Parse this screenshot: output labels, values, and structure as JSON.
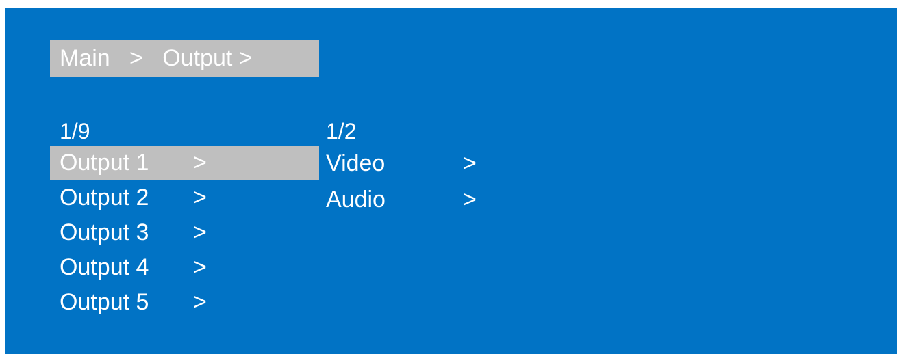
{
  "breadcrumb": {
    "items": [
      "Main",
      "Output"
    ],
    "separator": ">"
  },
  "left_menu": {
    "page_indicator": "1/9",
    "items": [
      {
        "label": "Output 1",
        "arrow": ">",
        "selected": true
      },
      {
        "label": "Output 2",
        "arrow": ">",
        "selected": false
      },
      {
        "label": "Output 3",
        "arrow": ">",
        "selected": false
      },
      {
        "label": "Output 4",
        "arrow": ">",
        "selected": false
      },
      {
        "label": "Output 5",
        "arrow": ">",
        "selected": false
      }
    ]
  },
  "right_menu": {
    "page_indicator": "1/2",
    "items": [
      {
        "label": "Video",
        "arrow": ">"
      },
      {
        "label": "Audio",
        "arrow": ">"
      }
    ]
  },
  "colors": {
    "background": "#0173c5",
    "highlight": "#bfbfbf",
    "text": "#ffffff"
  }
}
